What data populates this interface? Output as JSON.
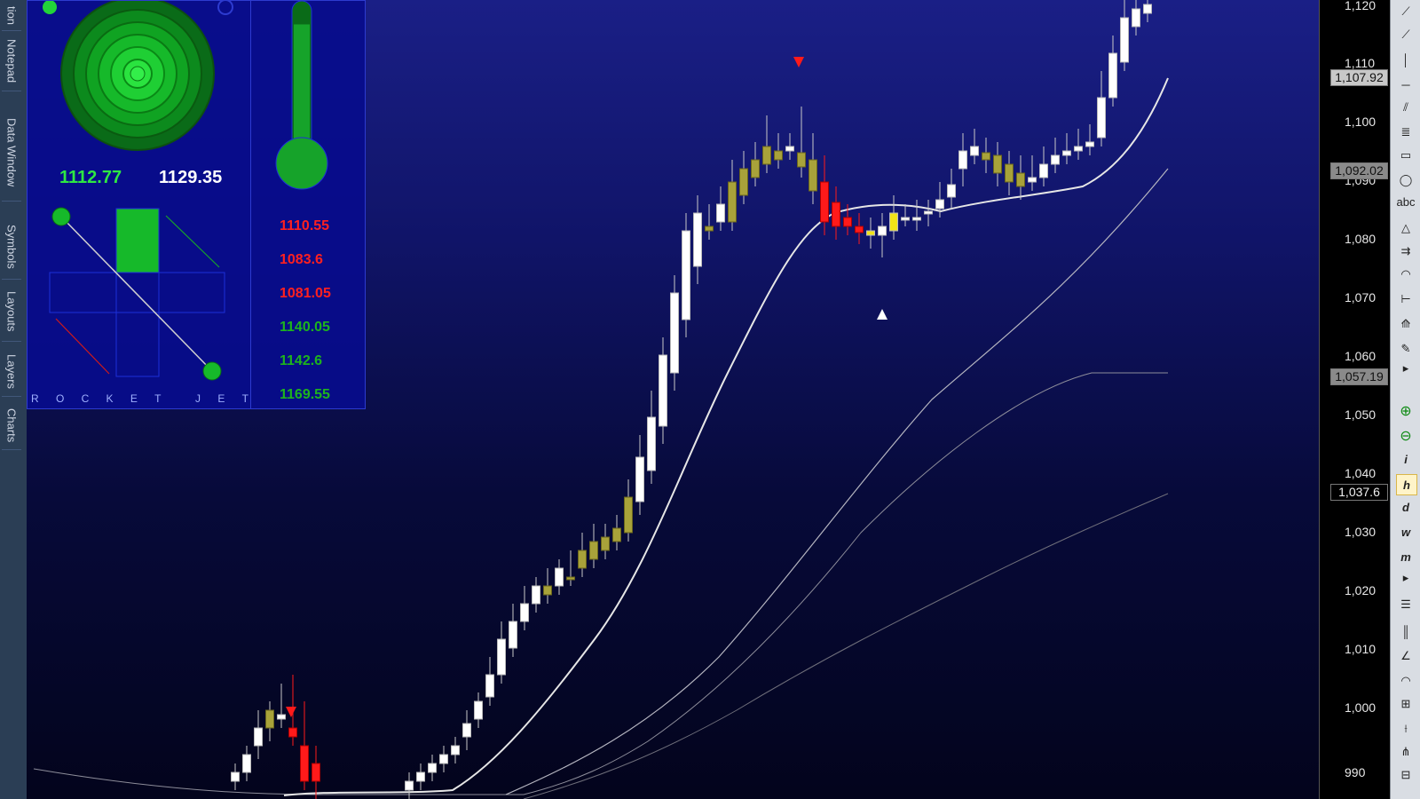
{
  "left_tabs": [
    "tion",
    "Notepad",
    "Data Window",
    "Symbols",
    "Layouts",
    "Layers",
    "Charts"
  ],
  "widget": {
    "value_green": "1112.77",
    "value_white": "1129.35",
    "levels": [
      {
        "text": "1110.55",
        "color": "#ff2020"
      },
      {
        "text": "1083.6",
        "color": "#ff2020"
      },
      {
        "text": "1081.05",
        "color": "#ff2020"
      },
      {
        "text": "1140.05",
        "color": "#1db41d"
      },
      {
        "text": "1142.6",
        "color": "#1db41d"
      },
      {
        "text": "1169.55",
        "color": "#1db41d"
      }
    ],
    "thermometer_level": 0.92,
    "label_letters": [
      "R",
      "O",
      "C",
      "K",
      "E",
      "T",
      "",
      "J",
      "E",
      "T"
    ]
  },
  "price_axis": {
    "ticks": [
      "1,120",
      "1,110",
      "1,100",
      "1,090",
      "1,080",
      "1,070",
      "1,060",
      "1,050",
      "1,040",
      "1,030",
      "1,020",
      "1,010",
      "1,000",
      "990"
    ],
    "price_boxes": [
      {
        "text": "1,107.92",
        "bg": "#c8c8c8",
        "fg": "#111"
      },
      {
        "text": "1,092.02",
        "bg": "#8a8a8a",
        "fg": "#111"
      },
      {
        "text": "1,057.19",
        "bg": "#8a8a8a",
        "fg": "#111"
      },
      {
        "text": "1,037.6",
        "bg": "#000000",
        "fg": "#f0f0f0"
      }
    ]
  },
  "colors": {
    "bull": "#ffffff",
    "bear_olive": "#a8a23a",
    "bear_red": "#ff1a1a",
    "doji_yellow": "#f2e418",
    "wick": "#c8c8c8"
  },
  "toolbar_icons": [
    "line-tool-icon",
    "segment-tool-icon",
    "vertical-line-icon",
    "horizontal-line-icon",
    "parallel-lines-icon",
    "fibonacci-icon",
    "rectangle-icon",
    "ellipse-icon",
    "text-tool-icon",
    "triangle-icon",
    "arrow-lines-icon",
    "arc-icon",
    "measure-icon",
    "polyline-icon",
    "pen-icon",
    "collapse-icon",
    "zoom-in-icon",
    "zoom-out-icon",
    "info-icon",
    "hourly-icon",
    "daily-icon",
    "weekly-icon",
    "monthly-icon",
    "collapse-icon-2",
    "lines-icon",
    "bars-icon",
    "gann-fan-icon",
    "arc-gann-icon",
    "grid-icon",
    "fan-icon",
    "pitchfork-icon",
    "table-icon"
  ]
}
